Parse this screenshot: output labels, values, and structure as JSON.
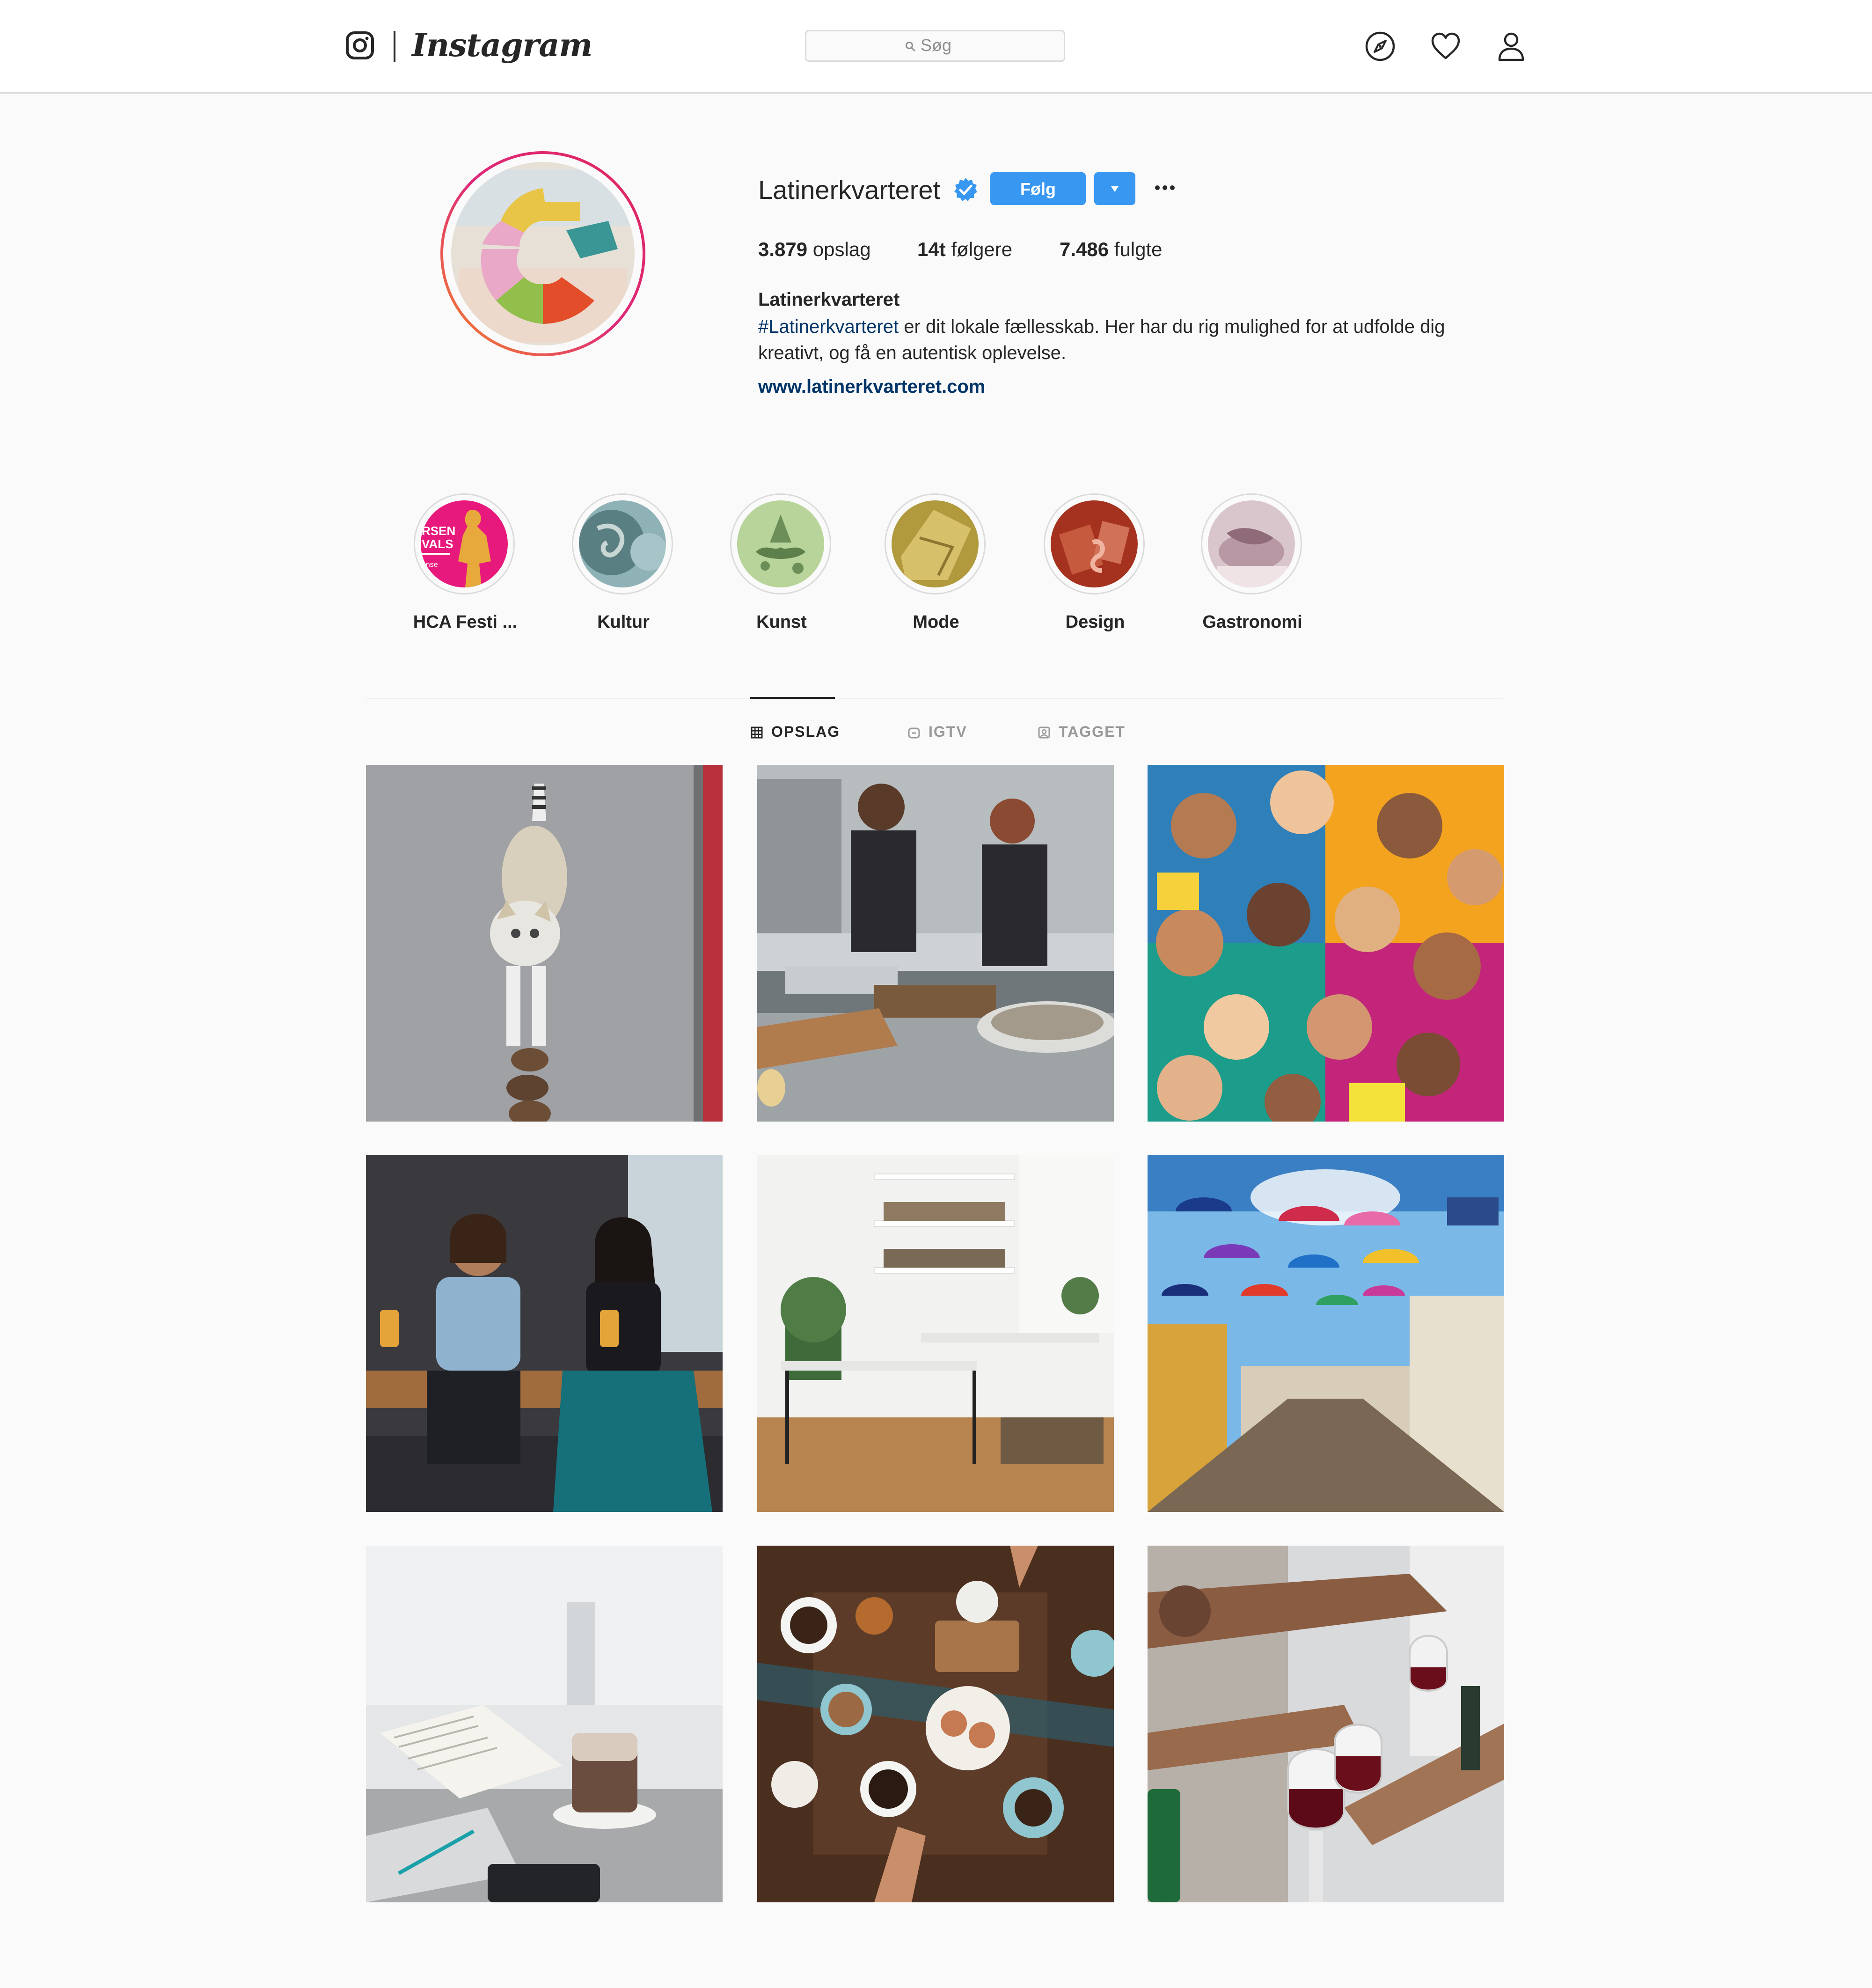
{
  "nav": {
    "brand": "Instagram",
    "search_placeholder": "Søg"
  },
  "profile": {
    "username": "Latinerkvarteret",
    "follow_label": "Følg",
    "stats": {
      "posts_count": "3.879",
      "posts_label": "opslag",
      "followers_count": "14t",
      "followers_label": "følgere",
      "following_count": "7.486",
      "following_label": "fulgte"
    },
    "bio": {
      "name": "Latinerkvarteret",
      "hashtag": "#Latinerkvarteret",
      "text_line1": " er dit lokale fællesskab. Her har du rig mulighed for at udfolde dig",
      "text_line2": "kreativt, og få en autentisk oplevelse.",
      "link": "www.latinerkvarteret.com"
    }
  },
  "highlights": [
    {
      "label": "HCA Festi ...",
      "badge_top": "RSEN",
      "badge_mid": "VALS",
      "badge_bot": "ense"
    },
    {
      "label": "Kultur"
    },
    {
      "label": "Kunst"
    },
    {
      "label": "Mode"
    },
    {
      "label": "Design"
    },
    {
      "label": "Gastronomi"
    }
  ],
  "tabs": [
    {
      "label": "OPSLAG",
      "icon": "grid-icon",
      "active": true
    },
    {
      "label": "IGTV",
      "icon": "igtv-icon",
      "active": false
    },
    {
      "label": "TAGGET",
      "icon": "tagged-icon",
      "active": false
    }
  ],
  "posts": [
    {
      "subject": "street-art-cat"
    },
    {
      "subject": "kitchen-chefs"
    },
    {
      "subject": "illustrated-crowd"
    },
    {
      "subject": "friends-laughing"
    },
    {
      "subject": "shop-interior"
    },
    {
      "subject": "umbrella-street"
    },
    {
      "subject": "coffee-and-book"
    },
    {
      "subject": "table-from-above"
    },
    {
      "subject": "wine-toast"
    }
  ],
  "colors": {
    "accent_blue": "#3897f0",
    "link_blue": "#003569",
    "text": "#262626",
    "muted": "#8e8e8e",
    "border": "#dbdbdb",
    "background": "#fafafa"
  }
}
